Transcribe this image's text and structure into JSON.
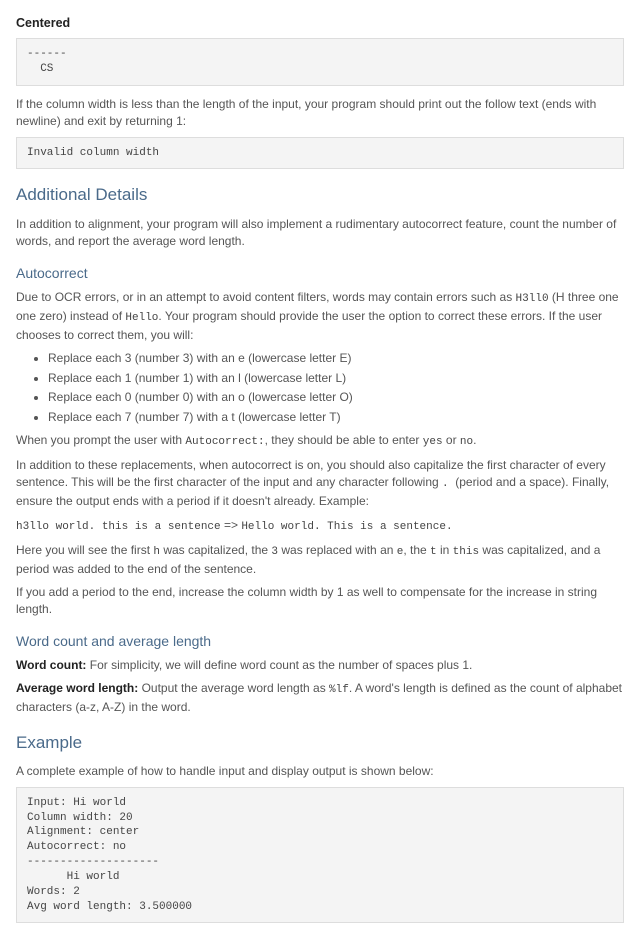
{
  "centered": {
    "title": "Centered",
    "code": "------\n  CS"
  },
  "invalid": {
    "intro": "If the column width is less than the length of the input, your program should print out the follow text (ends with newline) and exit by returning 1:",
    "code": "Invalid column width"
  },
  "details": {
    "title": "Additional Details",
    "intro": "In addition to alignment, your program will also implement a rudimentary autocorrect feature, count the number of words, and report the average word length."
  },
  "autocorrect": {
    "title": "Autocorrect",
    "intro_a": "Due to OCR errors, or in an attempt to avoid content filters, words may contain errors such as ",
    "code_a": "H3ll0",
    "intro_b": " (H three one one zero) instead of ",
    "code_b": "Hello",
    "intro_c": ". Your program should provide the user the option to correct these errors. If the user chooses to correct them, you will:",
    "rules": [
      "Replace each 3 (number 3) with an e (lowercase letter E)",
      "Replace each 1 (number 1) with an l (lowercase letter L)",
      "Replace each 0 (number 0) with an o (lowercase letter O)",
      "Replace each 7 (number 7) with a t (lowercase letter T)"
    ],
    "prompt_a": "When you prompt the user with ",
    "prompt_code": "Autocorrect:",
    "prompt_b": ", they should be able to enter ",
    "yes": "yes",
    "or": " or ",
    "no": "no",
    "prompt_c": ".",
    "cap_a": "In addition to these replacements, when autocorrect is on, you should also capitalize the first character of every sentence. This will be the first character of the input and any character following ",
    "cap_code": ". ",
    "cap_b": "(period and a space). Finally, ensure the output ends with a period if it doesn't already. Example:",
    "example_in": "h3llo world. this is a sentence",
    "example_arrow": " => ",
    "example_out": "Hello world. This is a sentence.",
    "explain_a": "Here you will see the first ",
    "ex_h": "h",
    "explain_b": " was capitalized, the ",
    "ex_3": "3",
    "explain_c": " was replaced with an ",
    "ex_e": "e",
    "explain_d": ", the ",
    "ex_t": "t",
    "explain_e": " in ",
    "ex_this": "this",
    "explain_f": " was capitalized, and a period was added to the end of the sentence.",
    "trailer": "If you add a period to the end, increase the column width by 1 as well to compensate for the increase in string length."
  },
  "wordcount": {
    "title": "Word count and average length",
    "wc_label": "Word count:",
    "wc_text": " For simplicity, we will define word count as the number of spaces plus 1.",
    "avg_label": "Average word length:",
    "avg_a": " Output the average word length as ",
    "avg_code": "%lf",
    "avg_b": ". A word's length is defined as the count of alphabet characters (a-z, A-Z) in the word."
  },
  "example": {
    "title": "Example",
    "intro": "A complete example of how to handle input and display output is shown below:",
    "code": "Input: Hi world\nColumn width: 20\nAlignment: center\nAutocorrect: no\n--------------------\n      Hi world\nWords: 2\nAvg word length: 3.500000"
  }
}
